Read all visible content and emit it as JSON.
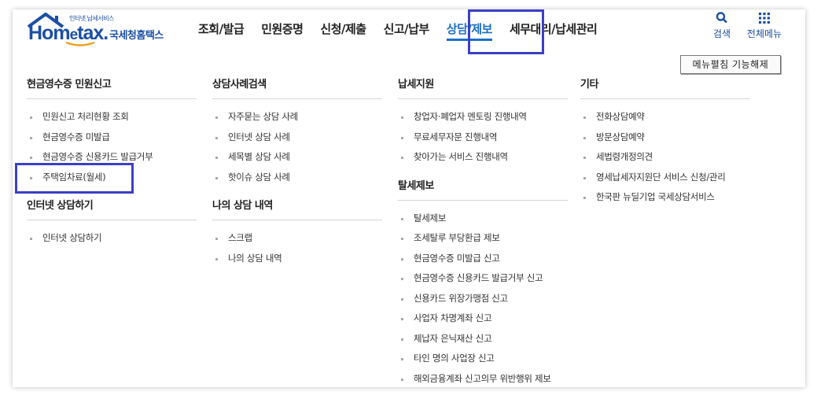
{
  "logo": {
    "subtitle": "인터넷 납세서비스",
    "brand_prefix": "Hom",
    "brand_e": "e",
    "brand_suffix": "tax.",
    "org_name": "국세청홈택스"
  },
  "gnb": {
    "items": [
      {
        "label": "조회/발급",
        "active": false
      },
      {
        "label": "민원증명",
        "active": false
      },
      {
        "label": "신청/제출",
        "active": false
      },
      {
        "label": "신고/납부",
        "active": false
      },
      {
        "label": "상담/제보",
        "active": true
      },
      {
        "label": "세무대리/납세관리",
        "active": false
      }
    ]
  },
  "util": {
    "search_label": "검색",
    "all_menu_label": "전체메뉴"
  },
  "menu_fold_button": "메뉴펼침 기능해제",
  "columns": [
    {
      "sections": [
        {
          "title": "현금영수증 민원신고",
          "items": [
            "민원신고 처리현황 조회",
            "현금영수증 미발급",
            "현금영수증 신용카드 발급거부",
            "주택임차료(월세)"
          ]
        },
        {
          "title": "인터넷 상담하기",
          "items": [
            "인터넷 상담하기"
          ]
        }
      ]
    },
    {
      "sections": [
        {
          "title": "상담사례검색",
          "items": [
            "자주묻는 상담 사례",
            "인터넷 상담 사례",
            "세목별 상담 사례",
            "핫이슈 상담 사례"
          ]
        },
        {
          "title": "나의 상담 내역",
          "items": [
            "스크랩",
            "나의 상담 내역"
          ]
        }
      ]
    },
    {
      "sections": [
        {
          "title": "납세지원",
          "items": [
            "창업자·폐업자 멘토링 진행내역",
            "무료세무자문 진행내역",
            "찾아가는 서비스 진행내역"
          ]
        },
        {
          "title": "탈세제보",
          "items": [
            "탈세제보",
            "조세탈루 부당환급 제보",
            "현금영수증 미발급 신고",
            "현금영수증 신용카드 발급거부 신고",
            "신용카드 위장가맹점 신고",
            "사업자 차명계좌 신고",
            "체납자 은닉재산 신고",
            "타인 명의 사업장 신고",
            "해외금융계좌 신고의무 위반행위 제보"
          ]
        }
      ]
    },
    {
      "sections": [
        {
          "title": "기타",
          "items": [
            "전화상담예약",
            "방문상담예약",
            "세법령개정의견",
            "영세납세자지원단 서비스 신청/관리",
            "한국판 뉴딜기업 국세상담서비스"
          ]
        }
      ]
    }
  ],
  "colors": {
    "brand": "#1b4fa3",
    "active_tab": "#1b6fc7",
    "highlight_box": "#3a3fc6"
  }
}
